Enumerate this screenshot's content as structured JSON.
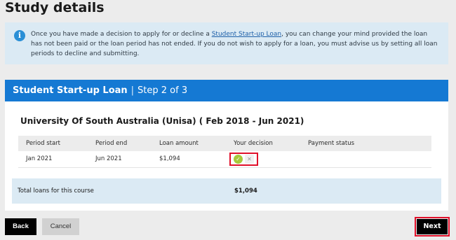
{
  "page": {
    "title": "Study details"
  },
  "info": {
    "text_before_link": "Once you have made a decision to apply for or decline a ",
    "link_text": "Student Start-up Loan",
    "text_after_link": ", you can change your mind provided the loan has not been paid or the loan period has not ended. If you do not wish to apply for a loan, you must advise us by setting all loan periods to decline and submitting.",
    "icon": "info-icon"
  },
  "step": {
    "product": "Student Start-up Loan",
    "separator": "|",
    "step_text": "Step 2 of 3"
  },
  "course": {
    "title": "University Of South Australia (Unisa) ( Feb 2018 - Jun 2021)"
  },
  "table": {
    "headers": [
      "Period start",
      "Period end",
      "Loan amount",
      "Your decision",
      "Payment status"
    ],
    "rows": [
      {
        "period_start": "Jan 2021",
        "period_end": "Jun 2021",
        "loan_amount": "$1,094",
        "decision": "accept",
        "payment_status": ""
      }
    ]
  },
  "totals": {
    "label": "Total loans for this course",
    "value": "$1,094"
  },
  "buttons": {
    "back": "Back",
    "cancel": "Cancel",
    "next": "Next"
  },
  "colors": {
    "accent": "#1579d3",
    "highlight": "#e0102a",
    "accept": "#a7c93b",
    "info_bg": "#dbeaf4"
  }
}
